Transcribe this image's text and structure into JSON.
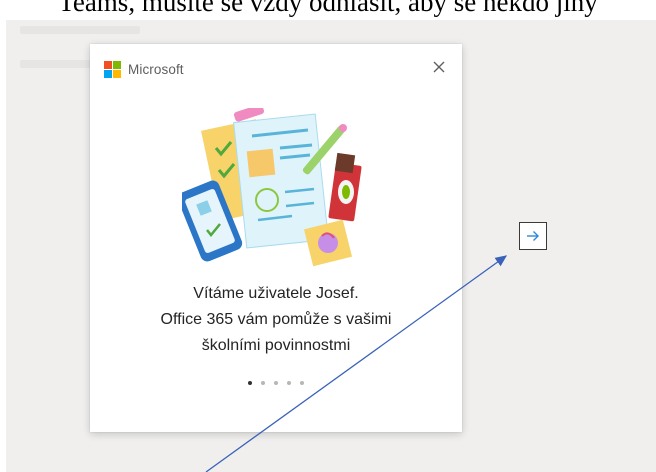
{
  "document": {
    "top_text": "Teams, musíte se vždy odhlásit, aby se někdo jiný"
  },
  "dialog": {
    "brand": "Microsoft",
    "close_icon": "close-icon",
    "welcome_lines": [
      "Vítáme uživatele Josef.",
      "Office 365 vám pomůže s vašimi",
      "školními povinnostmi"
    ],
    "pagination": {
      "total": 5,
      "current": 1
    }
  },
  "next_button": {
    "icon": "arrow-right-icon"
  },
  "colors": {
    "ms_red": "#f25022",
    "ms_green": "#7fba00",
    "ms_blue": "#00a4ef",
    "ms_yellow": "#ffb900",
    "annotation_arrow": "#3a63b8",
    "accent_blue": "#2b88d8"
  }
}
